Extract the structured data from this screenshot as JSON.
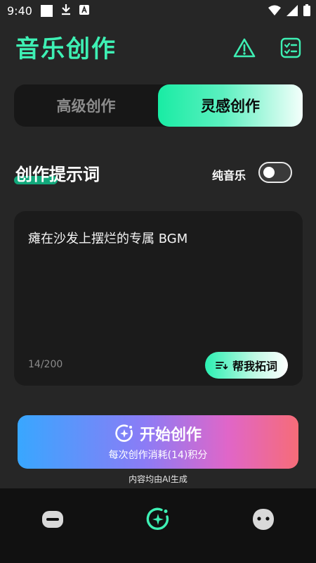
{
  "status_bar": {
    "time": "9:40"
  },
  "header": {
    "title": "音乐创作"
  },
  "mode_tabs": {
    "left": "高级创作",
    "right": "灵感创作",
    "active": "right"
  },
  "prompt_section": {
    "title": "创作提示词",
    "pure_music_label": "纯音乐",
    "pure_music_on": false
  },
  "prompt": {
    "text": "瘫在沙发上摆烂的专属 BGM",
    "count": "14/200",
    "expand_label": "帮我拓词"
  },
  "start": {
    "label": "开始创作",
    "sub": "每次创作消耗(14)积分"
  },
  "footer_note": "内容均由AI生成",
  "colors": {
    "accent": "#3ef0b4",
    "background": "#262626"
  },
  "bottom_nav": [
    "chat-bubble-icon",
    "music-create-icon",
    "alien-icon"
  ]
}
